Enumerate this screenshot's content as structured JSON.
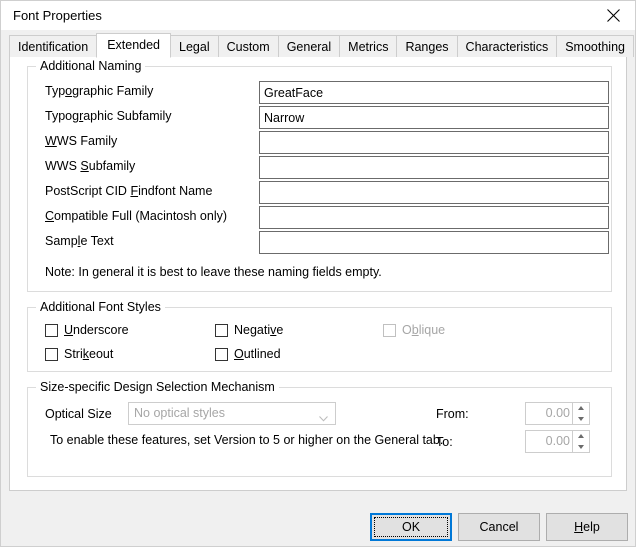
{
  "window": {
    "title": "Font Properties",
    "close_icon": "close-icon"
  },
  "tabs": [
    {
      "label": "Identification",
      "selected": false
    },
    {
      "label": "Extended",
      "selected": true
    },
    {
      "label": "Legal",
      "selected": false
    },
    {
      "label": "Custom",
      "selected": false
    },
    {
      "label": "General",
      "selected": false
    },
    {
      "label": "Metrics",
      "selected": false
    },
    {
      "label": "Ranges",
      "selected": false
    },
    {
      "label": "Characteristics",
      "selected": false
    },
    {
      "label": "Smoothing",
      "selected": false
    }
  ],
  "naming": {
    "group_title": "Additional Naming",
    "fields": [
      {
        "label": "Typographic Family",
        "value": "GreatFace",
        "placeholder": ""
      },
      {
        "label": "Typographic Subfamily",
        "value": "Narrow",
        "placeholder": ""
      },
      {
        "label": "WWS Family",
        "value": "",
        "placeholder": ""
      },
      {
        "label": "WWS Subfamily",
        "value": "",
        "placeholder": ""
      },
      {
        "label": "PostScript CID Findfont Name",
        "value": "",
        "placeholder": ""
      },
      {
        "label": "Compatible Full (Macintosh only)",
        "value": "",
        "placeholder": ""
      },
      {
        "label": "Sample Text",
        "value": "",
        "placeholder": ""
      }
    ],
    "note": "Note: In general it is best to leave these naming fields empty."
  },
  "styles": {
    "group_title": "Additional Font Styles",
    "checkboxes": [
      {
        "label": "Underscore",
        "checked": false,
        "disabled": false
      },
      {
        "label": "Negative",
        "checked": false,
        "disabled": false
      },
      {
        "label": "Oblique",
        "checked": false,
        "disabled": true
      },
      {
        "label": "Strikeout",
        "checked": false,
        "disabled": false
      },
      {
        "label": "Outlined",
        "checked": false,
        "disabled": false
      }
    ]
  },
  "size": {
    "group_title": "Size-specific Design Selection Mechanism",
    "optical_size_label": "Optical Size",
    "optical_size_value": "No optical styles",
    "hint": "To enable these features, set Version to 5 or higher on the General tab.",
    "from_label": "From:",
    "from_value": "0.00",
    "to_label": "To:",
    "to_value": "0.00"
  },
  "footer": {
    "ok_label": "OK",
    "cancel_label": "Cancel",
    "help_label": "Help"
  },
  "colors": {
    "accent": "#0078d7",
    "window_bg": "#f0f0f0",
    "panel_bg": "#ffffff",
    "disabled_text": "#a6a6a6"
  }
}
